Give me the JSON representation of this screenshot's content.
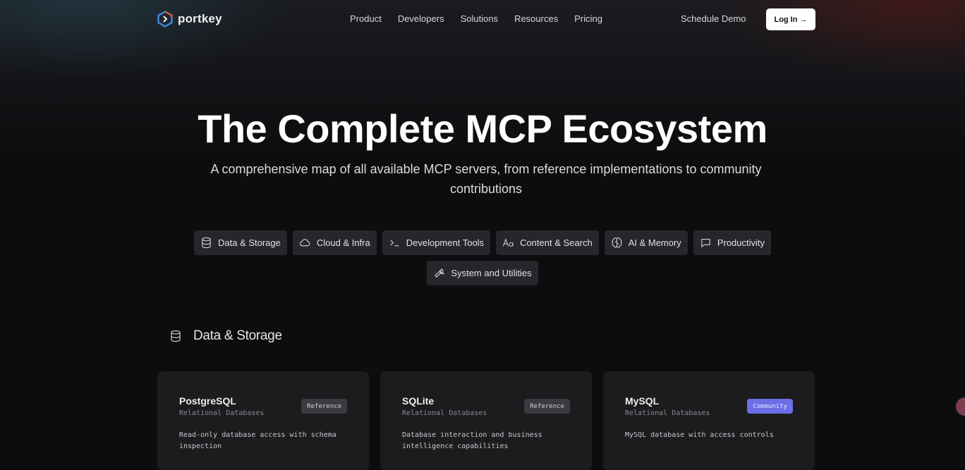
{
  "nav": {
    "brand": "portkey",
    "links": [
      "Product",
      "Developers",
      "Solutions",
      "Resources",
      "Pricing"
    ],
    "schedule_demo": "Schedule Demo",
    "login": "Log In →"
  },
  "hero": {
    "title": "The Complete MCP Ecosystem",
    "subtitle": "A comprehensive map of all available MCP servers, from reference implementations to community contributions"
  },
  "filters": [
    {
      "label": "Data & Storage",
      "icon": "database-icon"
    },
    {
      "label": "Cloud & Infra",
      "icon": "cloud-icon"
    },
    {
      "label": "Development Tools",
      "icon": "terminal-icon"
    },
    {
      "label": "Content & Search",
      "icon": "text-aa-icon"
    },
    {
      "label": "AI & Memory",
      "icon": "brain-icon"
    },
    {
      "label": "Productivity",
      "icon": "message-square-icon"
    },
    {
      "label": "System and Utilities",
      "icon": "wrench-icon"
    }
  ],
  "section": {
    "title": "Data & Storage",
    "icon": "database-icon"
  },
  "cards": [
    {
      "name": "PostgreSQL",
      "category": "Relational Databases",
      "badge": "Reference",
      "description": "Read-only database access with schema inspection"
    },
    {
      "name": "SQLite",
      "category": "Relational Databases",
      "badge": "Reference",
      "description": "Database interaction and business intelligence capabilities"
    },
    {
      "name": "MySQL",
      "category": "Relational Databases",
      "badge": "Community",
      "description": "MySQL database with access controls"
    }
  ],
  "colors": {
    "background": "#0d0d0f",
    "chip": "#26272b",
    "card": "#1c1c1f",
    "badge_reference": "#3a3b40",
    "badge_community": "#6b6ee6"
  }
}
